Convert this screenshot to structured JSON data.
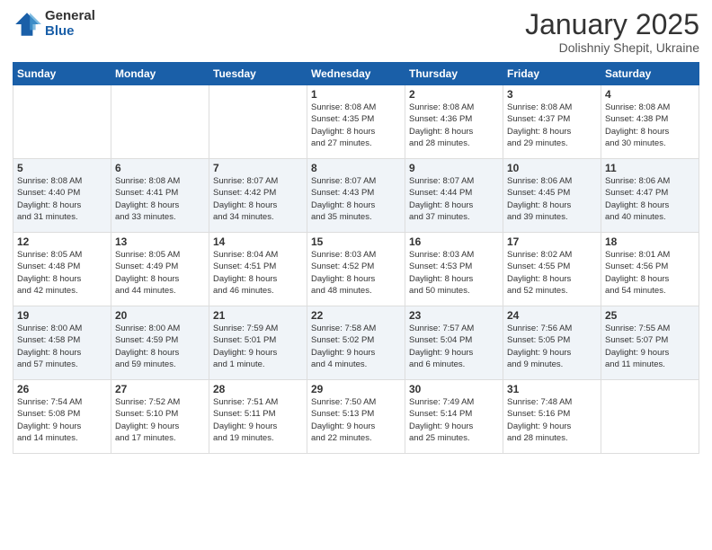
{
  "logo": {
    "general": "General",
    "blue": "Blue"
  },
  "header": {
    "month": "January 2025",
    "location": "Dolishniy Shepit, Ukraine"
  },
  "weekdays": [
    "Sunday",
    "Monday",
    "Tuesday",
    "Wednesday",
    "Thursday",
    "Friday",
    "Saturday"
  ],
  "weeks": [
    [
      {
        "day": "",
        "info": ""
      },
      {
        "day": "",
        "info": ""
      },
      {
        "day": "",
        "info": ""
      },
      {
        "day": "1",
        "info": "Sunrise: 8:08 AM\nSunset: 4:35 PM\nDaylight: 8 hours\nand 27 minutes."
      },
      {
        "day": "2",
        "info": "Sunrise: 8:08 AM\nSunset: 4:36 PM\nDaylight: 8 hours\nand 28 minutes."
      },
      {
        "day": "3",
        "info": "Sunrise: 8:08 AM\nSunset: 4:37 PM\nDaylight: 8 hours\nand 29 minutes."
      },
      {
        "day": "4",
        "info": "Sunrise: 8:08 AM\nSunset: 4:38 PM\nDaylight: 8 hours\nand 30 minutes."
      }
    ],
    [
      {
        "day": "5",
        "info": "Sunrise: 8:08 AM\nSunset: 4:40 PM\nDaylight: 8 hours\nand 31 minutes."
      },
      {
        "day": "6",
        "info": "Sunrise: 8:08 AM\nSunset: 4:41 PM\nDaylight: 8 hours\nand 33 minutes."
      },
      {
        "day": "7",
        "info": "Sunrise: 8:07 AM\nSunset: 4:42 PM\nDaylight: 8 hours\nand 34 minutes."
      },
      {
        "day": "8",
        "info": "Sunrise: 8:07 AM\nSunset: 4:43 PM\nDaylight: 8 hours\nand 35 minutes."
      },
      {
        "day": "9",
        "info": "Sunrise: 8:07 AM\nSunset: 4:44 PM\nDaylight: 8 hours\nand 37 minutes."
      },
      {
        "day": "10",
        "info": "Sunrise: 8:06 AM\nSunset: 4:45 PM\nDaylight: 8 hours\nand 39 minutes."
      },
      {
        "day": "11",
        "info": "Sunrise: 8:06 AM\nSunset: 4:47 PM\nDaylight: 8 hours\nand 40 minutes."
      }
    ],
    [
      {
        "day": "12",
        "info": "Sunrise: 8:05 AM\nSunset: 4:48 PM\nDaylight: 8 hours\nand 42 minutes."
      },
      {
        "day": "13",
        "info": "Sunrise: 8:05 AM\nSunset: 4:49 PM\nDaylight: 8 hours\nand 44 minutes."
      },
      {
        "day": "14",
        "info": "Sunrise: 8:04 AM\nSunset: 4:51 PM\nDaylight: 8 hours\nand 46 minutes."
      },
      {
        "day": "15",
        "info": "Sunrise: 8:03 AM\nSunset: 4:52 PM\nDaylight: 8 hours\nand 48 minutes."
      },
      {
        "day": "16",
        "info": "Sunrise: 8:03 AM\nSunset: 4:53 PM\nDaylight: 8 hours\nand 50 minutes."
      },
      {
        "day": "17",
        "info": "Sunrise: 8:02 AM\nSunset: 4:55 PM\nDaylight: 8 hours\nand 52 minutes."
      },
      {
        "day": "18",
        "info": "Sunrise: 8:01 AM\nSunset: 4:56 PM\nDaylight: 8 hours\nand 54 minutes."
      }
    ],
    [
      {
        "day": "19",
        "info": "Sunrise: 8:00 AM\nSunset: 4:58 PM\nDaylight: 8 hours\nand 57 minutes."
      },
      {
        "day": "20",
        "info": "Sunrise: 8:00 AM\nSunset: 4:59 PM\nDaylight: 8 hours\nand 59 minutes."
      },
      {
        "day": "21",
        "info": "Sunrise: 7:59 AM\nSunset: 5:01 PM\nDaylight: 9 hours\nand 1 minute."
      },
      {
        "day": "22",
        "info": "Sunrise: 7:58 AM\nSunset: 5:02 PM\nDaylight: 9 hours\nand 4 minutes."
      },
      {
        "day": "23",
        "info": "Sunrise: 7:57 AM\nSunset: 5:04 PM\nDaylight: 9 hours\nand 6 minutes."
      },
      {
        "day": "24",
        "info": "Sunrise: 7:56 AM\nSunset: 5:05 PM\nDaylight: 9 hours\nand 9 minutes."
      },
      {
        "day": "25",
        "info": "Sunrise: 7:55 AM\nSunset: 5:07 PM\nDaylight: 9 hours\nand 11 minutes."
      }
    ],
    [
      {
        "day": "26",
        "info": "Sunrise: 7:54 AM\nSunset: 5:08 PM\nDaylight: 9 hours\nand 14 minutes."
      },
      {
        "day": "27",
        "info": "Sunrise: 7:52 AM\nSunset: 5:10 PM\nDaylight: 9 hours\nand 17 minutes."
      },
      {
        "day": "28",
        "info": "Sunrise: 7:51 AM\nSunset: 5:11 PM\nDaylight: 9 hours\nand 19 minutes."
      },
      {
        "day": "29",
        "info": "Sunrise: 7:50 AM\nSunset: 5:13 PM\nDaylight: 9 hours\nand 22 minutes."
      },
      {
        "day": "30",
        "info": "Sunrise: 7:49 AM\nSunset: 5:14 PM\nDaylight: 9 hours\nand 25 minutes."
      },
      {
        "day": "31",
        "info": "Sunrise: 7:48 AM\nSunset: 5:16 PM\nDaylight: 9 hours\nand 28 minutes."
      },
      {
        "day": "",
        "info": ""
      }
    ]
  ]
}
